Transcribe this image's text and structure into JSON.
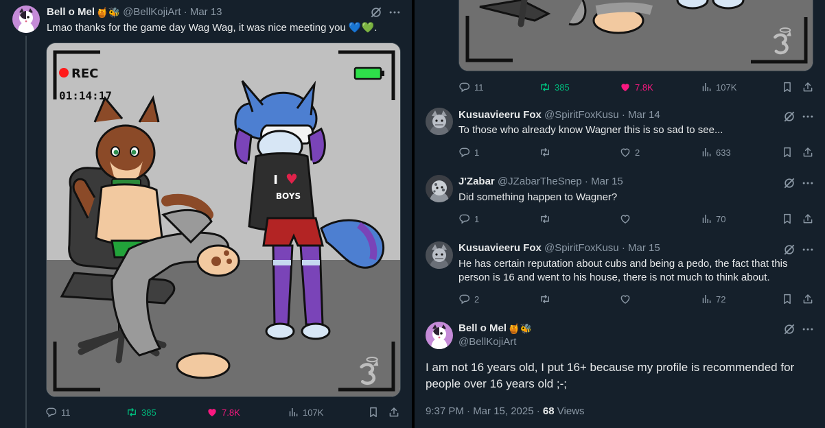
{
  "colors": {
    "bg": "#15202b",
    "text": "#e7e9ea",
    "muted": "#8b98a5",
    "retweet": "#00ba7c",
    "like": "#f91880",
    "rec_red": "#ff1a1a",
    "battery": "#2ee04a"
  },
  "left": {
    "tweet": {
      "author_name": "Bell o Mel",
      "author_emojis": "🍯🐝",
      "handle": "@BellKojiArt",
      "date": "· Mar 13",
      "text": "Lmao thanks for the game day Wag Wag, it was nice meeting you 💙💚.",
      "media": {
        "rec_label": "REC",
        "timer": "01:14:17",
        "shirt_line1": "I",
        "shirt_heart": "♥",
        "shirt_line2": "BOYS"
      },
      "stats": {
        "replies": "11",
        "retweets": "385",
        "likes": "7.8K",
        "views": "107K"
      },
      "icons": [
        "grok-icon",
        "more-icon",
        "reply-icon",
        "retweet-icon",
        "like-icon",
        "views-icon",
        "bookmark-icon",
        "share-icon"
      ]
    }
  },
  "right": {
    "top_stats": {
      "replies": "11",
      "retweets": "385",
      "likes": "7.8K",
      "views": "107K"
    },
    "replies": [
      {
        "name": "Kusuavieeru Fox",
        "handle": "@SpiritFoxKusu",
        "date": "· Mar 14",
        "text": "To those who already know Wagner this is so sad to see...",
        "reply_count": "1",
        "retweet_count": "",
        "like_count": "2",
        "view_count": "633"
      },
      {
        "name": "J'Zabar",
        "handle": "@JZabarTheSnep",
        "date": "· Mar 15",
        "text": "Did something happen to Wagner?",
        "reply_count": "1",
        "retweet_count": "",
        "like_count": "",
        "view_count": "70"
      },
      {
        "name": "Kusuavieeru Fox",
        "handle": "@SpiritFoxKusu",
        "date": "· Mar 15",
        "text_line1": "He has certain reputation about cubs and being a pedo, the fact that this",
        "text_line2": "person is 16 and went to his house, there is not much to think about.",
        "reply_count": "2",
        "retweet_count": "",
        "like_count": "",
        "view_count": "72"
      }
    ],
    "focused": {
      "name": "Bell o Mel",
      "emojis": "🍯🐝",
      "handle": "@BellKojiArt",
      "text_line1": "I am not 16 years old, I put 16+ because my profile is recommended for",
      "text_line2": "people over 16 years old ;-;",
      "timestamp": "9:37 PM · Mar 15, 2025 · ",
      "views_count": "68",
      "views_label": " Views"
    }
  }
}
